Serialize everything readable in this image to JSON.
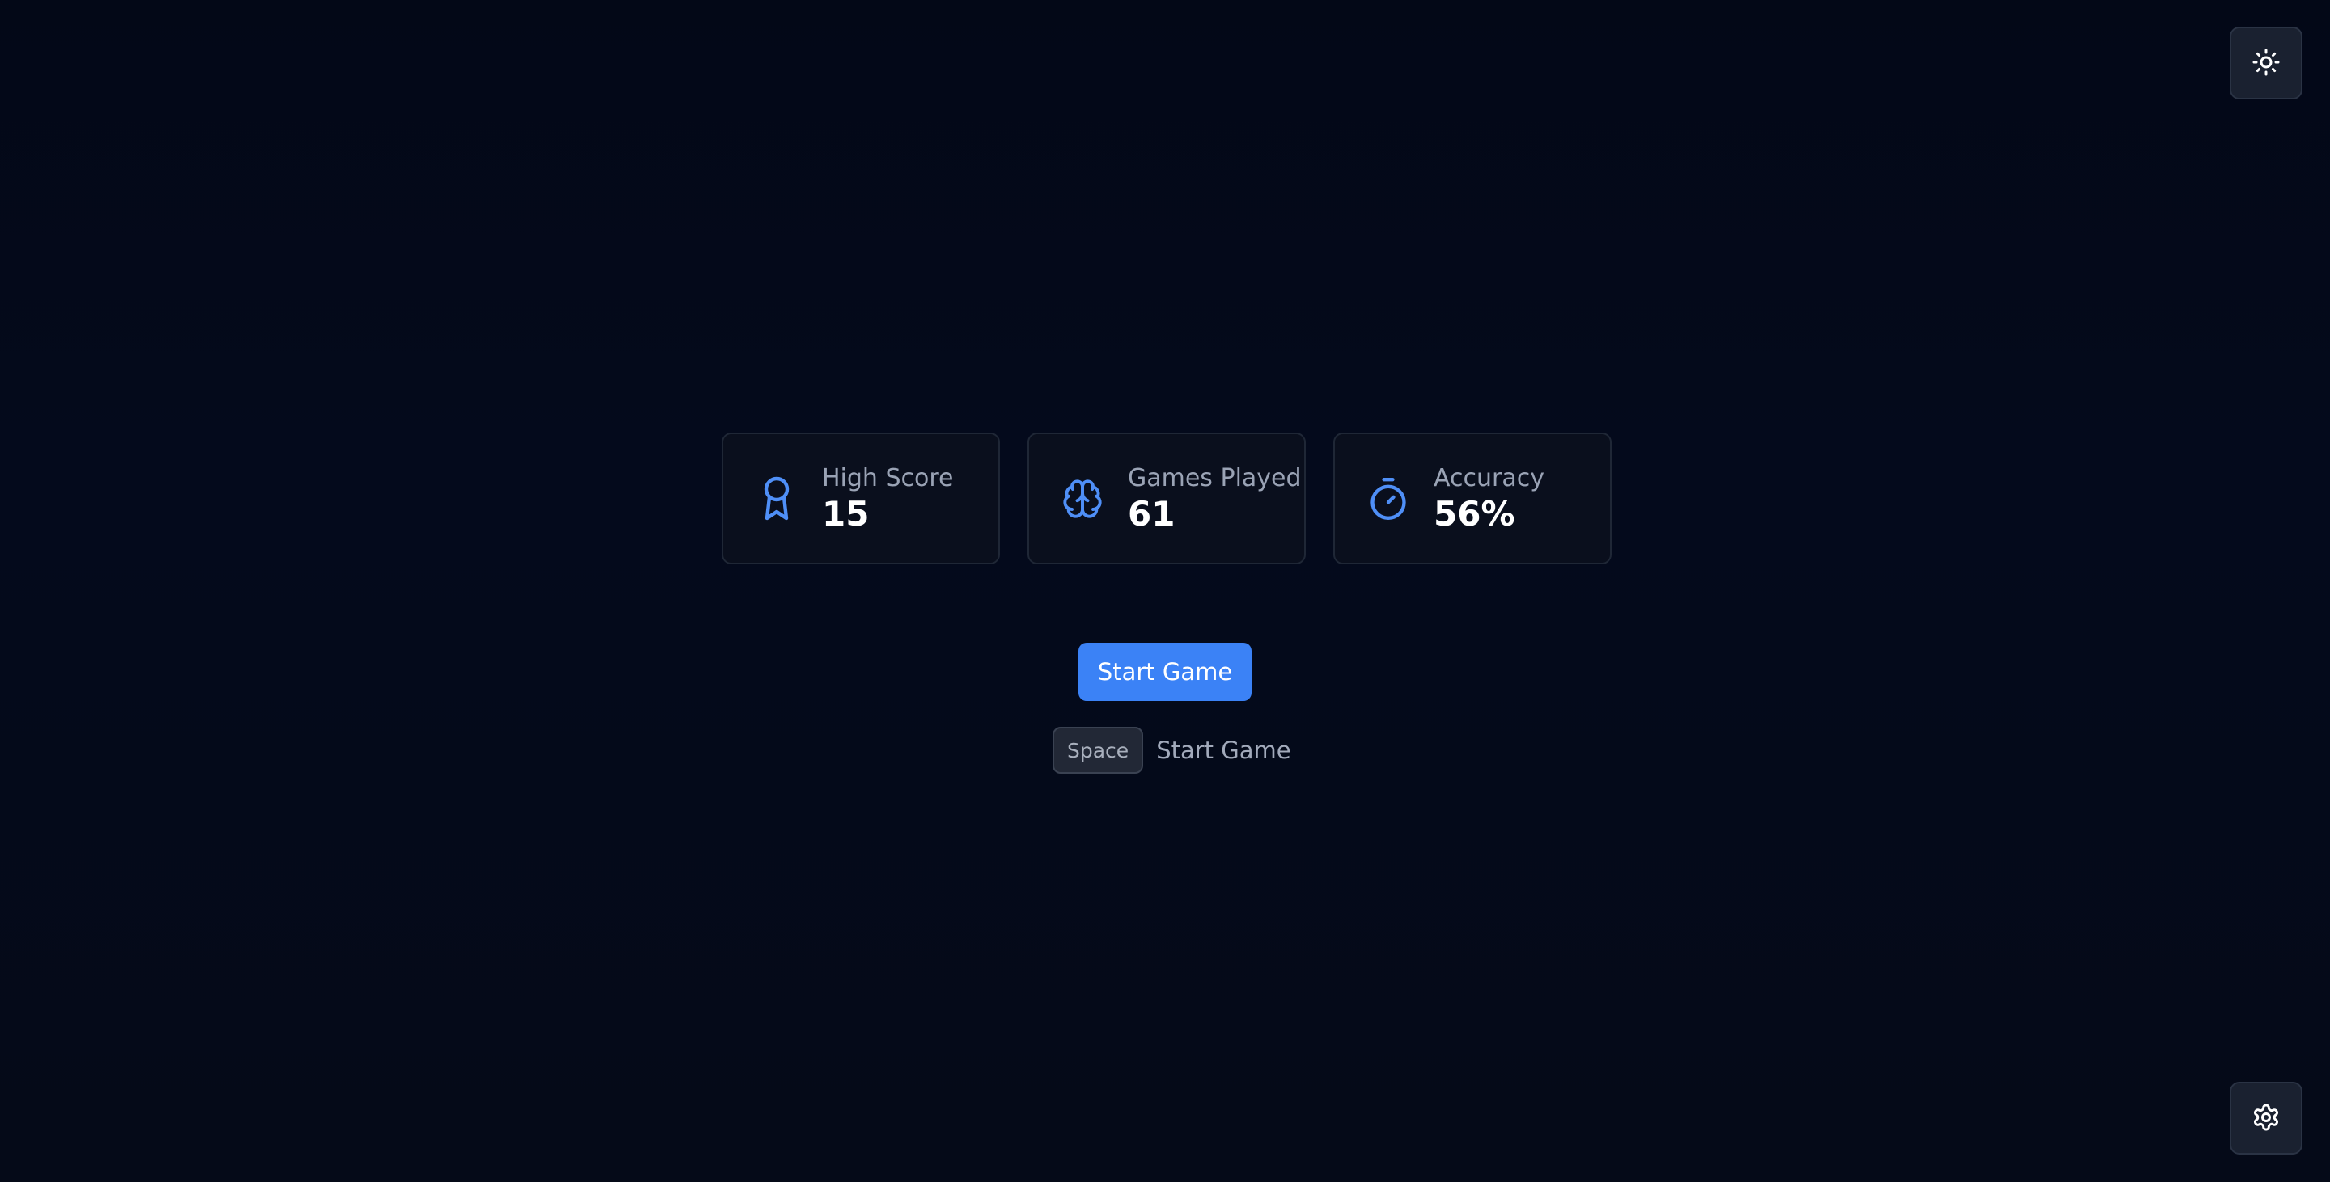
{
  "theme_toggle": {
    "icon": "sun-icon"
  },
  "settings": {
    "icon": "gear-icon"
  },
  "stats": [
    {
      "label": "High Score",
      "value": "15",
      "icon": "award-icon"
    },
    {
      "label": "Games Played",
      "value": "61",
      "icon": "brain-icon"
    },
    {
      "label": "Accuracy",
      "value": "56%",
      "icon": "timer-icon"
    }
  ],
  "start_button": {
    "label": "Start Game"
  },
  "shortcut": {
    "key": "Space",
    "label": "Start Game"
  },
  "colors": {
    "accent": "#3b82f6",
    "icon_blue": "#4f8ff7",
    "background": "#030817",
    "card": "#0a0f1d"
  }
}
